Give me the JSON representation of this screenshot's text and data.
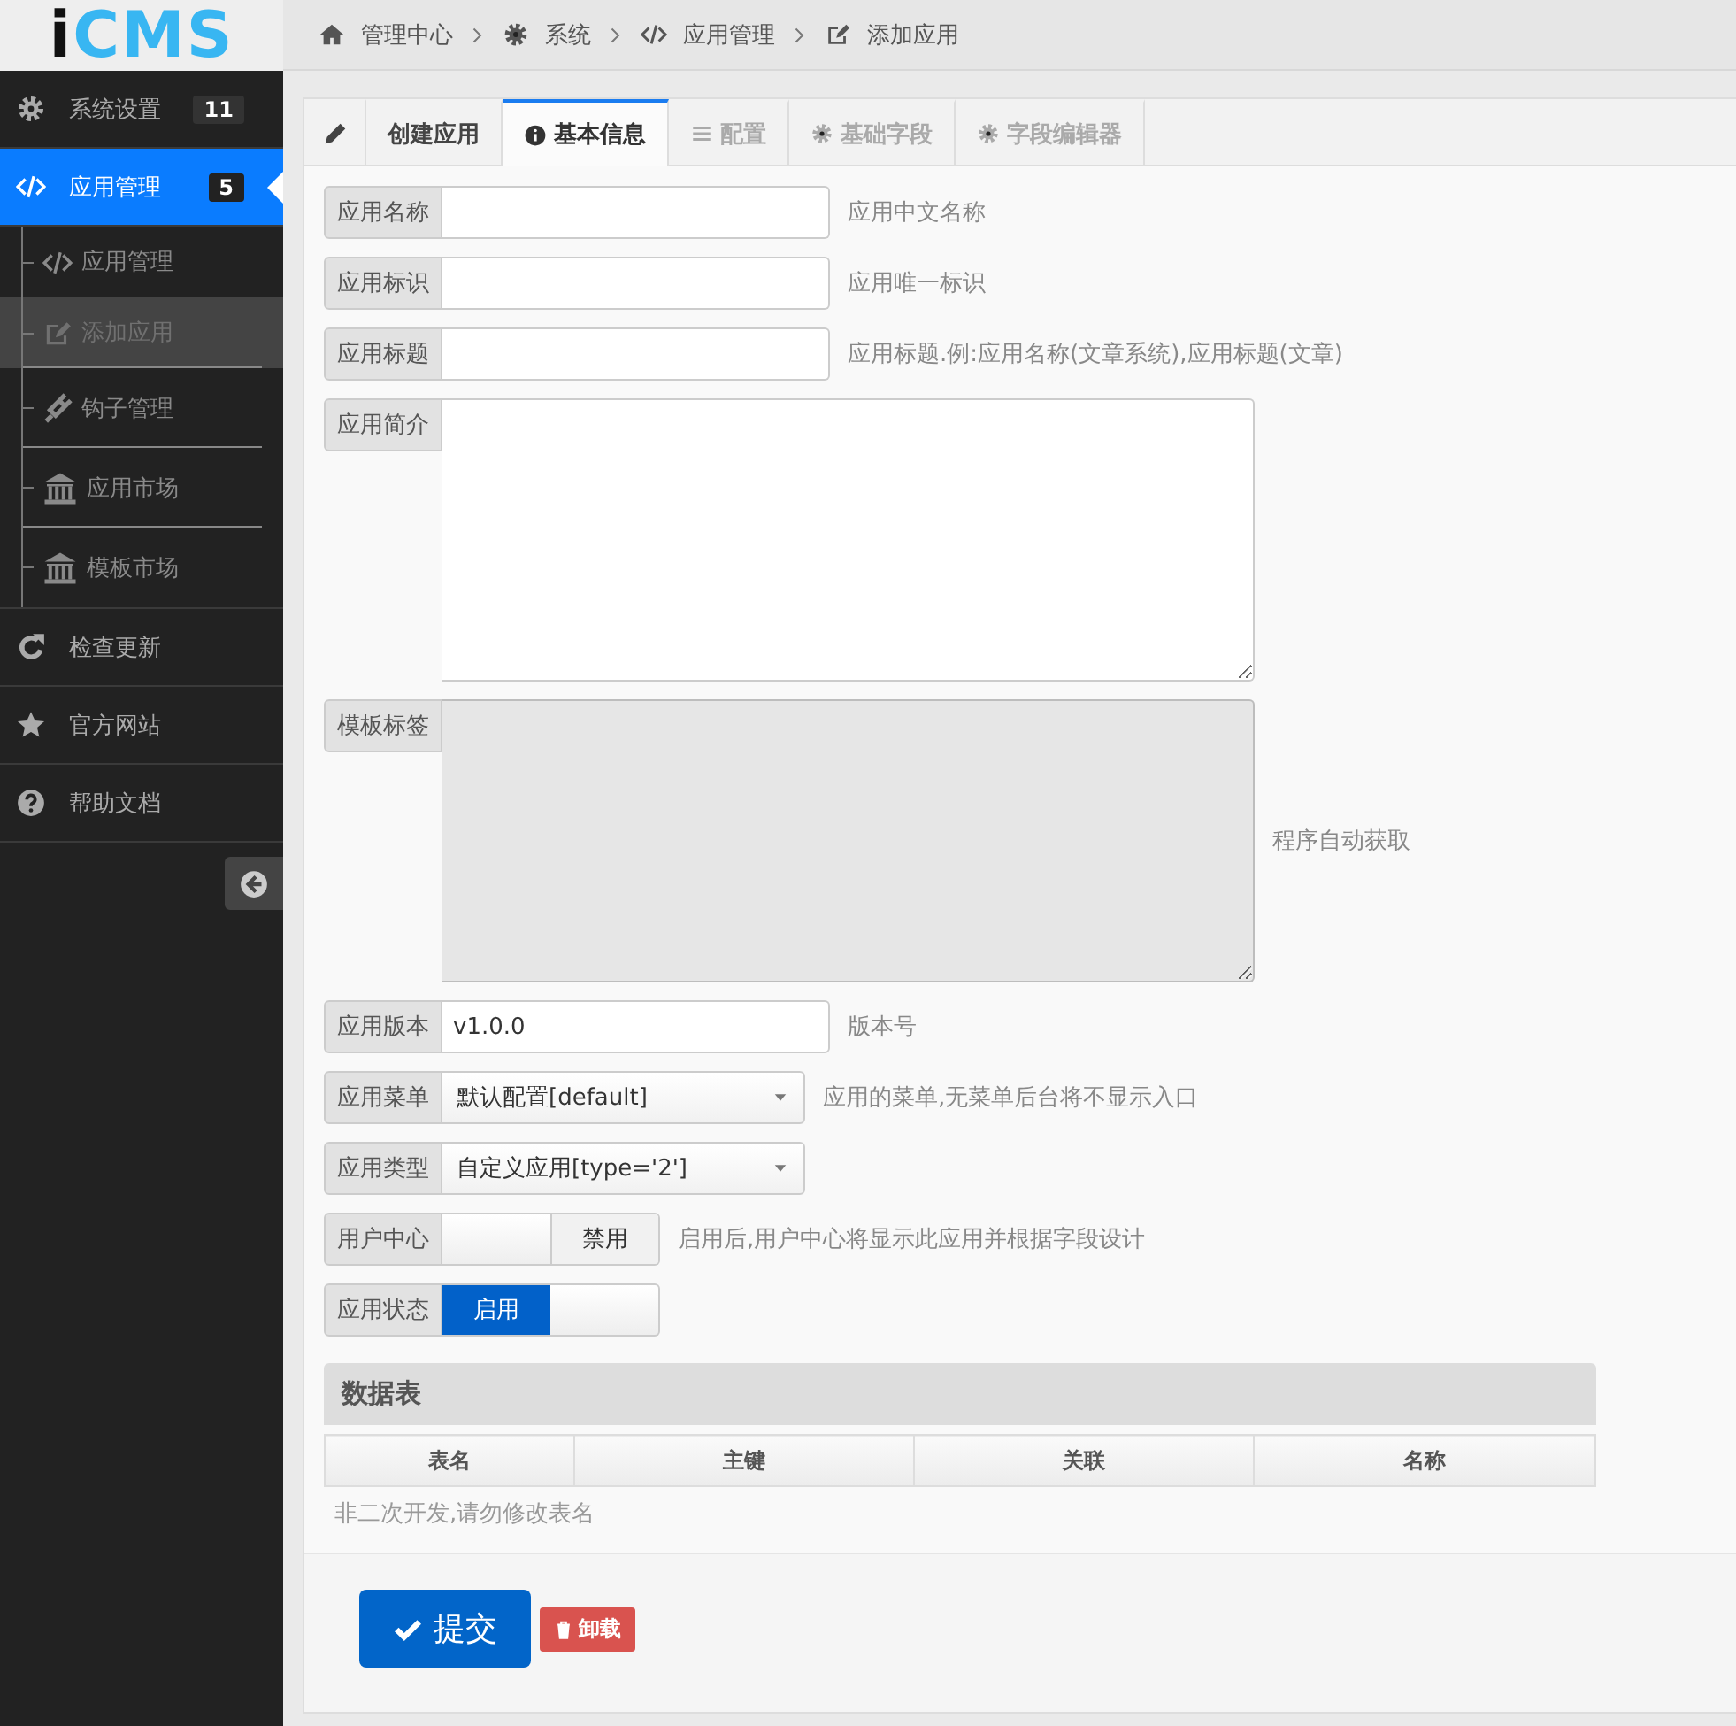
{
  "logo": {
    "dark": "i",
    "accent": "CMS"
  },
  "breadcrumbs": [
    {
      "kind": "home",
      "label": "管理中心"
    },
    {
      "kind": "gear",
      "label": "系统"
    },
    {
      "kind": "code",
      "label": "应用管理"
    },
    {
      "kind": "edit",
      "label": "添加应用"
    }
  ],
  "sidebar": {
    "items": [
      {
        "kind": "gear",
        "label": "系统设置",
        "badge": "11",
        "selected": false
      },
      {
        "kind": "code",
        "label": "应用管理",
        "badge": "5",
        "selected": true,
        "children": [
          {
            "kind": "code",
            "label": "应用管理",
            "selected": false
          },
          {
            "kind": "edit",
            "label": "添加应用",
            "selected": true
          },
          {
            "kind": "plug",
            "label": "钩子管理",
            "selected": false
          },
          {
            "kind": "bank",
            "label": "应用市场",
            "selected": false
          },
          {
            "kind": "bank",
            "label": "模板市场",
            "selected": false
          }
        ]
      },
      {
        "kind": "refresh",
        "label": "检查更新",
        "selected": false
      },
      {
        "kind": "star",
        "label": "官方网站",
        "selected": false
      },
      {
        "kind": "help",
        "label": "帮助文档",
        "selected": false
      }
    ]
  },
  "tabs": [
    {
      "kind": "pencil",
      "selected": false,
      "disabled": false
    },
    {
      "kind": "none",
      "label": "创建应用",
      "selected": false,
      "disabled": false
    },
    {
      "kind": "info",
      "label": "基本信息",
      "selected": true,
      "disabled": false
    },
    {
      "kind": "list",
      "label": "配置",
      "selected": false,
      "disabled": true
    },
    {
      "kind": "gear",
      "label": "基础字段",
      "selected": false,
      "disabled": true
    },
    {
      "kind": "gear",
      "label": "字段编辑器",
      "selected": false,
      "disabled": true
    }
  ],
  "form": {
    "fields": [
      {
        "kind": "text",
        "label": "应用名称",
        "help": "应用中文名称"
      },
      {
        "kind": "text",
        "label": "应用标识",
        "help": "应用唯一标识"
      },
      {
        "kind": "text",
        "label": "应用标题",
        "help": "应用标题.例:应用名称(文章系统),应用标题(文章)"
      },
      {
        "kind": "textarea",
        "label": "应用简介",
        "disabled": false
      },
      {
        "kind": "textarea",
        "label": "模板标签",
        "disabled": true,
        "help": "程序自动获取"
      },
      {
        "kind": "text",
        "label": "应用版本",
        "value": "v1.0.0",
        "help": "版本号"
      },
      {
        "kind": "select",
        "label": "应用菜单",
        "value": "默认配置[default]",
        "help": "应用的菜单,无菜单后台将不显示入口"
      },
      {
        "kind": "select",
        "label": "应用类型",
        "value": "自定义应用[type='2']"
      },
      {
        "kind": "switch",
        "label": "用户中心",
        "on": false,
        "state_label": "禁用",
        "help": "启用后,用户中心将显示此应用并根据字段设计"
      },
      {
        "kind": "switch",
        "label": "应用状态",
        "on": true,
        "state_label": "启用"
      }
    ]
  },
  "data_table": {
    "title": "数据表",
    "columns": [
      "表名",
      "主键",
      "关联",
      "名称"
    ],
    "note": "非二次开发,请勿修改表名"
  },
  "actions": [
    {
      "kind": "primary",
      "label": "提交"
    },
    {
      "kind": "danger",
      "label": "卸载"
    }
  ]
}
